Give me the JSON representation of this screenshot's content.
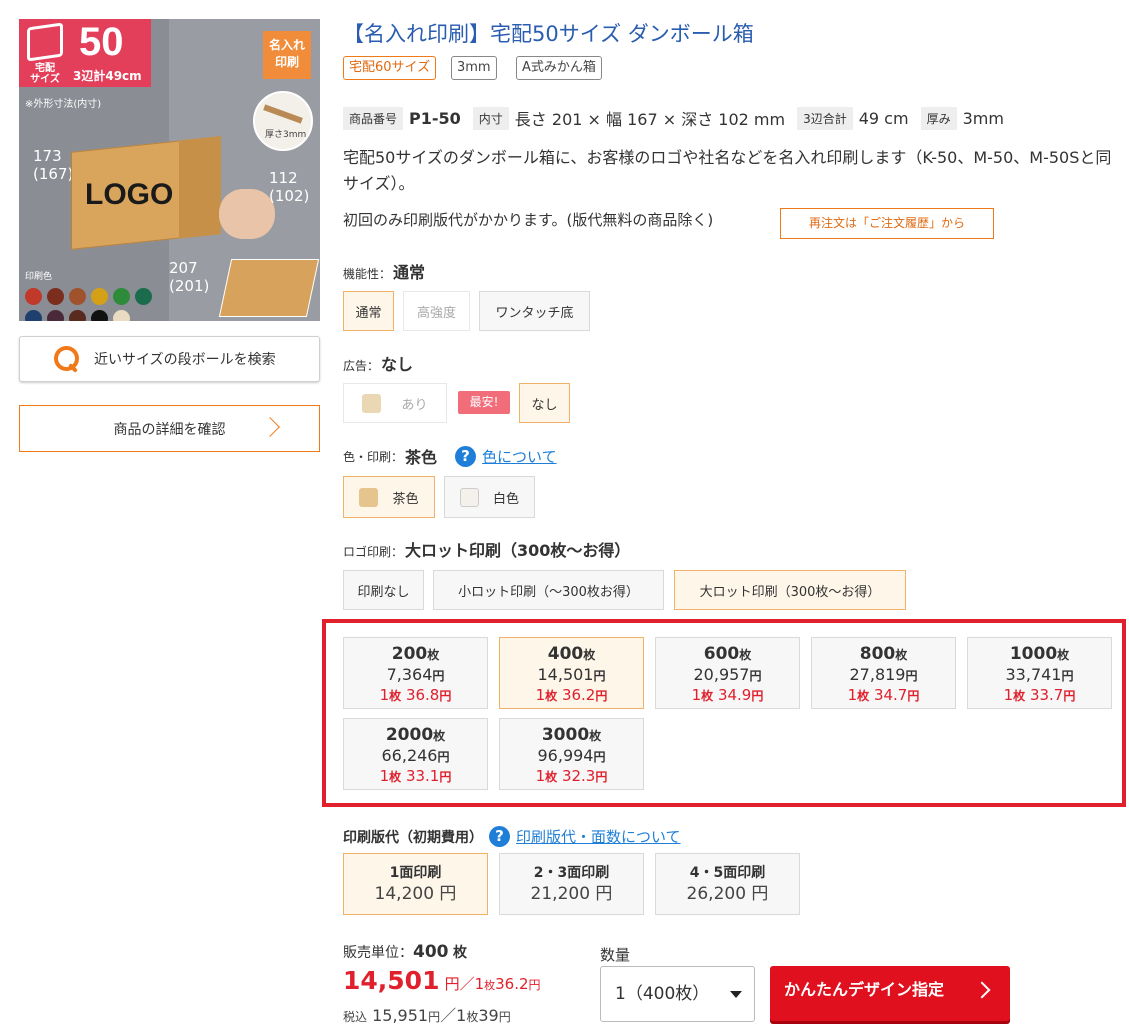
{
  "hero": {
    "badge_small": "宅配\nサイズ",
    "badge_size": "50",
    "badge_sum": "3辺計49cm",
    "stamp": "名入れ\n印刷",
    "thickness_note": "厚さ3mm",
    "outer_note": "※外形寸法(内寸)",
    "dim_height": "173\n(167)",
    "dim_right": "112\n(102)",
    "dim_bottom": "207\n(201)",
    "logo_text": "LOGO",
    "color_label": "印刷色",
    "print_colors_row1": [
      "#c0392b",
      "#7b2e1e",
      "#a0522d",
      "#d4a017",
      "#2e8b3a",
      "#1b6b4d"
    ],
    "print_colors_row2": [
      "#1f3f6e",
      "#4a2a3a",
      "#5a2a1e",
      "#111111",
      "#e9dcc2"
    ]
  },
  "left": {
    "search_label": "近いサイズの段ボールを検索",
    "detail_label": "商品の詳細を確認"
  },
  "product": {
    "title": "【名入れ印刷】宅配50サイズ ダンボール箱",
    "tags": [
      "宅配60サイズ",
      "3mm",
      "A式みかん箱"
    ],
    "spec": {
      "code_label": "商品番号",
      "code": "P1-50",
      "inner_label": "内寸",
      "inner": "長さ 201 × 幅 167 × 深さ 102 mm",
      "sum_label": "3辺合計",
      "sum": "49 cm",
      "thick_label": "厚み",
      "thick": "3mm"
    },
    "description": "宅配50サイズのダンボール箱に、お客様のロゴや社名などを名入れ印刷します（K-50、M-50、M-50Sと同サイズ）。",
    "plate_note": "初回のみ印刷版代がかかります。(版代無料の商品除く)",
    "reorder_label": "再注文は「ご注文履歴」から"
  },
  "function": {
    "label": "機能性：",
    "value": "通常",
    "options": [
      "通常",
      "高強度",
      "ワンタッチ底"
    ]
  },
  "ad": {
    "label": "広告：",
    "value": "なし",
    "options": [
      "あり",
      "なし"
    ],
    "best_badge": "最安!"
  },
  "color": {
    "label": "色・印刷：",
    "value": "茶色",
    "help_link": "色について",
    "options": [
      "茶色",
      "白色"
    ],
    "swatches": [
      "#e6c48e",
      "#f4f1ec"
    ]
  },
  "logo_print": {
    "label": "ロゴ印刷：",
    "value": "大ロット印刷（300枚〜お得）",
    "options": [
      "印刷なし",
      "小ロット印刷（〜300枚お得）",
      "大ロット印刷（300枚〜お得）"
    ]
  },
  "quantities": [
    {
      "qty": "200",
      "price": "7,364",
      "unit": "36.8"
    },
    {
      "qty": "400",
      "price": "14,501",
      "unit": "36.2"
    },
    {
      "qty": "600",
      "price": "20,957",
      "unit": "34.9"
    },
    {
      "qty": "800",
      "price": "27,819",
      "unit": "34.7"
    },
    {
      "qty": "1000",
      "price": "33,741",
      "unit": "33.7"
    },
    {
      "qty": "2000",
      "price": "66,246",
      "unit": "33.1"
    },
    {
      "qty": "3000",
      "price": "96,994",
      "unit": "32.3"
    }
  ],
  "units": {
    "sheet": "枚",
    "yen": "円",
    "per_prefix": "1",
    "question": "?"
  },
  "plate": {
    "label": "印刷版代（初期費用）",
    "help_link": "印刷版代・面数について",
    "options": [
      {
        "name": "1面印刷",
        "price": "14,200 円"
      },
      {
        "name": "2・3面印刷",
        "price": "21,200 円"
      },
      {
        "name": "4・5面印刷",
        "price": "26,200 円"
      }
    ]
  },
  "order": {
    "unit_label": "販売単位：",
    "unit_value": "400",
    "price": "14,501",
    "price_suffix": "円／",
    "per_unit": "36.2",
    "tax_label": "税込",
    "tax_price": "15,951",
    "tax_per_unit": "39",
    "qty_label": "数量",
    "qty_value": "1（400枚）",
    "cta": "かんたんデザイン指定"
  }
}
